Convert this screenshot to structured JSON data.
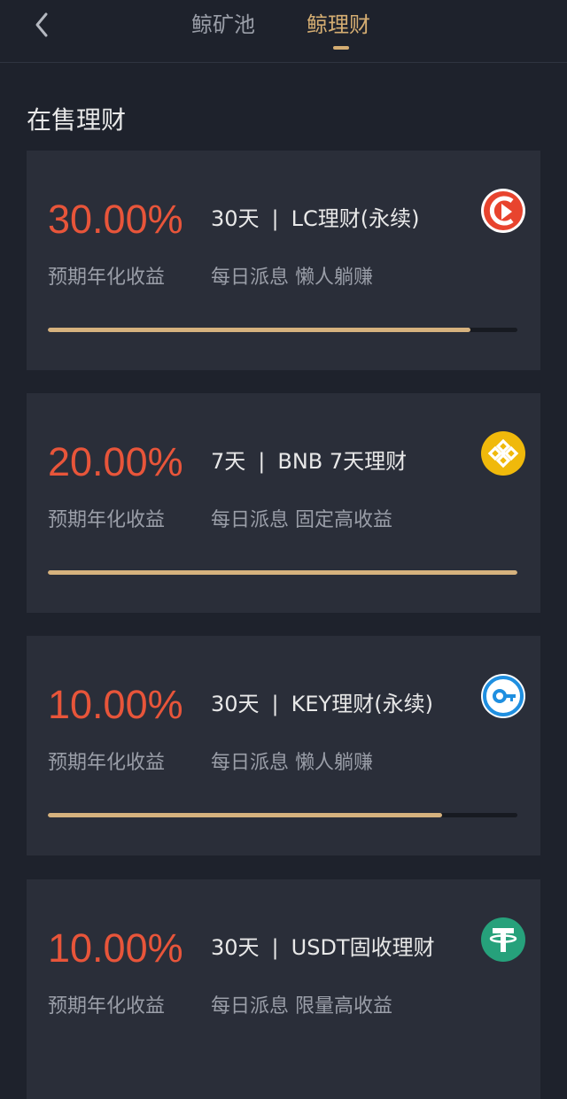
{
  "header": {
    "tabs": [
      {
        "label": "鲸矿池",
        "active": false
      },
      {
        "label": "鲸理财",
        "active": true
      }
    ]
  },
  "section_title": "在售理财",
  "products": [
    {
      "rate": "30.00%",
      "rate_label": "预期年化收益",
      "term": "30天",
      "separator": "|",
      "name": "LC理财(永续)",
      "desc": "每日派息 懒人躺赚",
      "icon": "lc-coin-icon",
      "icon_color": "#e8442e",
      "progress": 0.9
    },
    {
      "rate": "20.00%",
      "rate_label": "预期年化收益",
      "term": "7天",
      "separator": "|",
      "name": "BNB 7天理财",
      "desc": "每日派息 固定高收益",
      "icon": "bnb-coin-icon",
      "icon_color": "#f0b90b",
      "progress": 1.0
    },
    {
      "rate": "10.00%",
      "rate_label": "预期年化收益",
      "term": "30天",
      "separator": "|",
      "name": "KEY理财(永续)",
      "desc": "每日派息 懒人躺赚",
      "icon": "key-coin-icon",
      "icon_color": "#1f8fe0",
      "progress": 0.84
    },
    {
      "rate": "10.00%",
      "rate_label": "预期年化收益",
      "term": "30天",
      "separator": "|",
      "name": "USDT固收理财",
      "desc": "每日派息 限量高收益",
      "icon": "usdt-coin-icon",
      "icon_color": "#26a17b",
      "progress": 0.0
    }
  ],
  "colors": {
    "background": "#1e222c",
    "card": "#2a2e39",
    "accent": "#d4ad72",
    "rate": "#e8553a"
  }
}
